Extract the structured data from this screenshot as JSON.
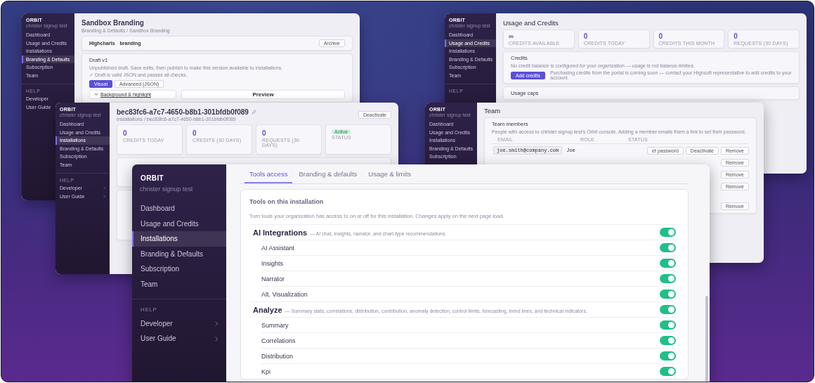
{
  "branding_window": {
    "sidebar": {
      "brand": "ORBIT",
      "org": "christer signup test",
      "items": [
        {
          "label": "Dashboard",
          "selected": false
        },
        {
          "label": "Usage and Credits",
          "selected": false
        },
        {
          "label": "Installations",
          "selected": false
        },
        {
          "label": "Branding & Defaults",
          "selected": true
        },
        {
          "label": "Subscription",
          "selected": false
        },
        {
          "label": "Team",
          "selected": false
        }
      ],
      "help_label": "HELP",
      "help_items": [
        {
          "label": "Developer"
        },
        {
          "label": "User Guide"
        }
      ]
    },
    "title": "Sandbox Branding",
    "breadcrumb": "Branding & Defaults / Sandbox Branding",
    "tags": [
      "Highcharts",
      "branding"
    ],
    "archive_button": "Archive",
    "draft": {
      "title": "Draft v1",
      "note": "Unpublished draft. Save edits, then publish to make this version available to installations.",
      "check": "✓ Draft is valid JSON and passes all checks.",
      "modes": [
        {
          "label": "Visual",
          "selected": true
        },
        {
          "label": "Advanced (JSON)",
          "selected": false
        }
      ],
      "section": "Background & highlight",
      "preview": "Preview"
    }
  },
  "usage_window": {
    "sidebar": {
      "brand": "ORBIT",
      "org": "christer signup test",
      "items": [
        {
          "label": "Dashboard",
          "selected": false
        },
        {
          "label": "Usage and Credits",
          "selected": true
        },
        {
          "label": "Installations",
          "selected": false
        },
        {
          "label": "Branding & Defaults",
          "selected": false
        },
        {
          "label": "Subscription",
          "selected": false
        },
        {
          "label": "Team",
          "selected": false
        }
      ],
      "help_label": "HELP"
    },
    "title": "Usage and Credits",
    "stats": [
      {
        "value": "∞",
        "label": "CREDITS AVAILABLE"
      },
      {
        "value": "0",
        "label": "CREDITS TODAY"
      },
      {
        "value": "0",
        "label": "CREDITS THIS MONTH"
      },
      {
        "value": "0",
        "label": "REQUESTS (30 DAYS)"
      }
    ],
    "credits": {
      "title": "Credits",
      "note": "No credit balance is configured for your organization — usage is not balance-limited.",
      "button": "Add credits",
      "info": "Purchasing credits from the portal is coming soon — contact your Highsoft representative to add credits to your account."
    },
    "caps_title": "Usage caps"
  },
  "installation_window": {
    "sidebar": {
      "brand": "ORBIT",
      "org": "christer signup test",
      "items": [
        {
          "label": "Dashboard",
          "selected": false
        },
        {
          "label": "Usage and Credits",
          "selected": false
        },
        {
          "label": "Installations",
          "selected": true
        },
        {
          "label": "Branding & Defaults",
          "selected": false
        },
        {
          "label": "Subscription",
          "selected": false
        },
        {
          "label": "Team",
          "selected": false
        }
      ],
      "help_label": "HELP",
      "help_items": [
        {
          "label": "Developer"
        },
        {
          "label": "User Guide"
        }
      ]
    },
    "title": "bec83fc6-a7c7-4650-b8b1-301bfdb0f089",
    "breadcrumb": "Installations / bec83fc6-a7c7-4650-b8b1-301bfdb0f089",
    "deactivate_button": "Deactivate",
    "stats": [
      {
        "value": "0",
        "label": "CREDITS TODAY"
      },
      {
        "value": "0",
        "label": "CREDITS (30 DAYS)"
      },
      {
        "value": "0",
        "label": "REQUESTS (30 DAYS)"
      }
    ],
    "status": {
      "badge": "Active",
      "label": "STATUS"
    }
  },
  "team_window": {
    "sidebar": {
      "brand": "ORBIT",
      "org": "christer signup test",
      "items": [
        {
          "label": "Dashboard",
          "selected": false
        },
        {
          "label": "Usage and Credits",
          "selected": false
        },
        {
          "label": "Installations",
          "selected": false
        },
        {
          "label": "Branding & Defaults",
          "selected": false
        },
        {
          "label": "Subscription",
          "selected": false
        }
      ]
    },
    "title": "Team",
    "card_title": "Team members",
    "note": "People with access to christer signup test's Orbit console. Adding a member emails them a link to set their password.",
    "columns": [
      "EMAIL",
      "ROLE",
      "STATUS"
    ],
    "first_row": {
      "email": "joe.smith@company.com",
      "name": "Joe",
      "actions": [
        "et password",
        "Deactivate",
        "Remove"
      ]
    },
    "more_rows": [
      {
        "action": "Remove"
      },
      {
        "action": "Remove"
      },
      {
        "action": "Remove"
      },
      {
        "action": "Remove"
      }
    ]
  },
  "tools_window": {
    "sidebar": {
      "brand": "ORBIT",
      "org": "christer signup test",
      "items": [
        {
          "label": "Dashboard",
          "selected": false
        },
        {
          "label": "Usage and Credits",
          "selected": false
        },
        {
          "label": "Installations",
          "selected": true
        },
        {
          "label": "Branding & Defaults",
          "selected": false
        },
        {
          "label": "Subscription",
          "selected": false
        },
        {
          "label": "Team",
          "selected": false
        }
      ],
      "help_label": "HELP",
      "help_items": [
        {
          "label": "Developer"
        },
        {
          "label": "User Guide"
        }
      ]
    },
    "tabs": [
      {
        "label": "Tools access",
        "selected": true
      },
      {
        "label": "Branding & defaults",
        "selected": false
      },
      {
        "label": "Usage & limits",
        "selected": false
      }
    ],
    "card_title": "Tools on this installation",
    "description": "Turn tools your organization has access to on or off for this installation. Changes apply on the next page load.",
    "groups": [
      {
        "name": "AI Integrations",
        "description": "— AI chat, insights, narrator, and chart-type recommendations.",
        "on": true,
        "tools": [
          {
            "label": "AI Assistant",
            "on": true
          },
          {
            "label": "Insights",
            "on": true
          },
          {
            "label": "Narrator",
            "on": true
          },
          {
            "label": "Alt. Visualization",
            "on": true
          }
        ]
      },
      {
        "name": "Analyze",
        "description": "— Summary stats, correlations, distribution, contribution, anomaly detection, control limits, forecasting, trend lines, and technical indicators.",
        "on": true,
        "tools": [
          {
            "label": "Summary",
            "on": true
          },
          {
            "label": "Correlations",
            "on": true
          },
          {
            "label": "Distribution",
            "on": true
          },
          {
            "label": "Kpi",
            "on": true
          }
        ]
      }
    ]
  }
}
